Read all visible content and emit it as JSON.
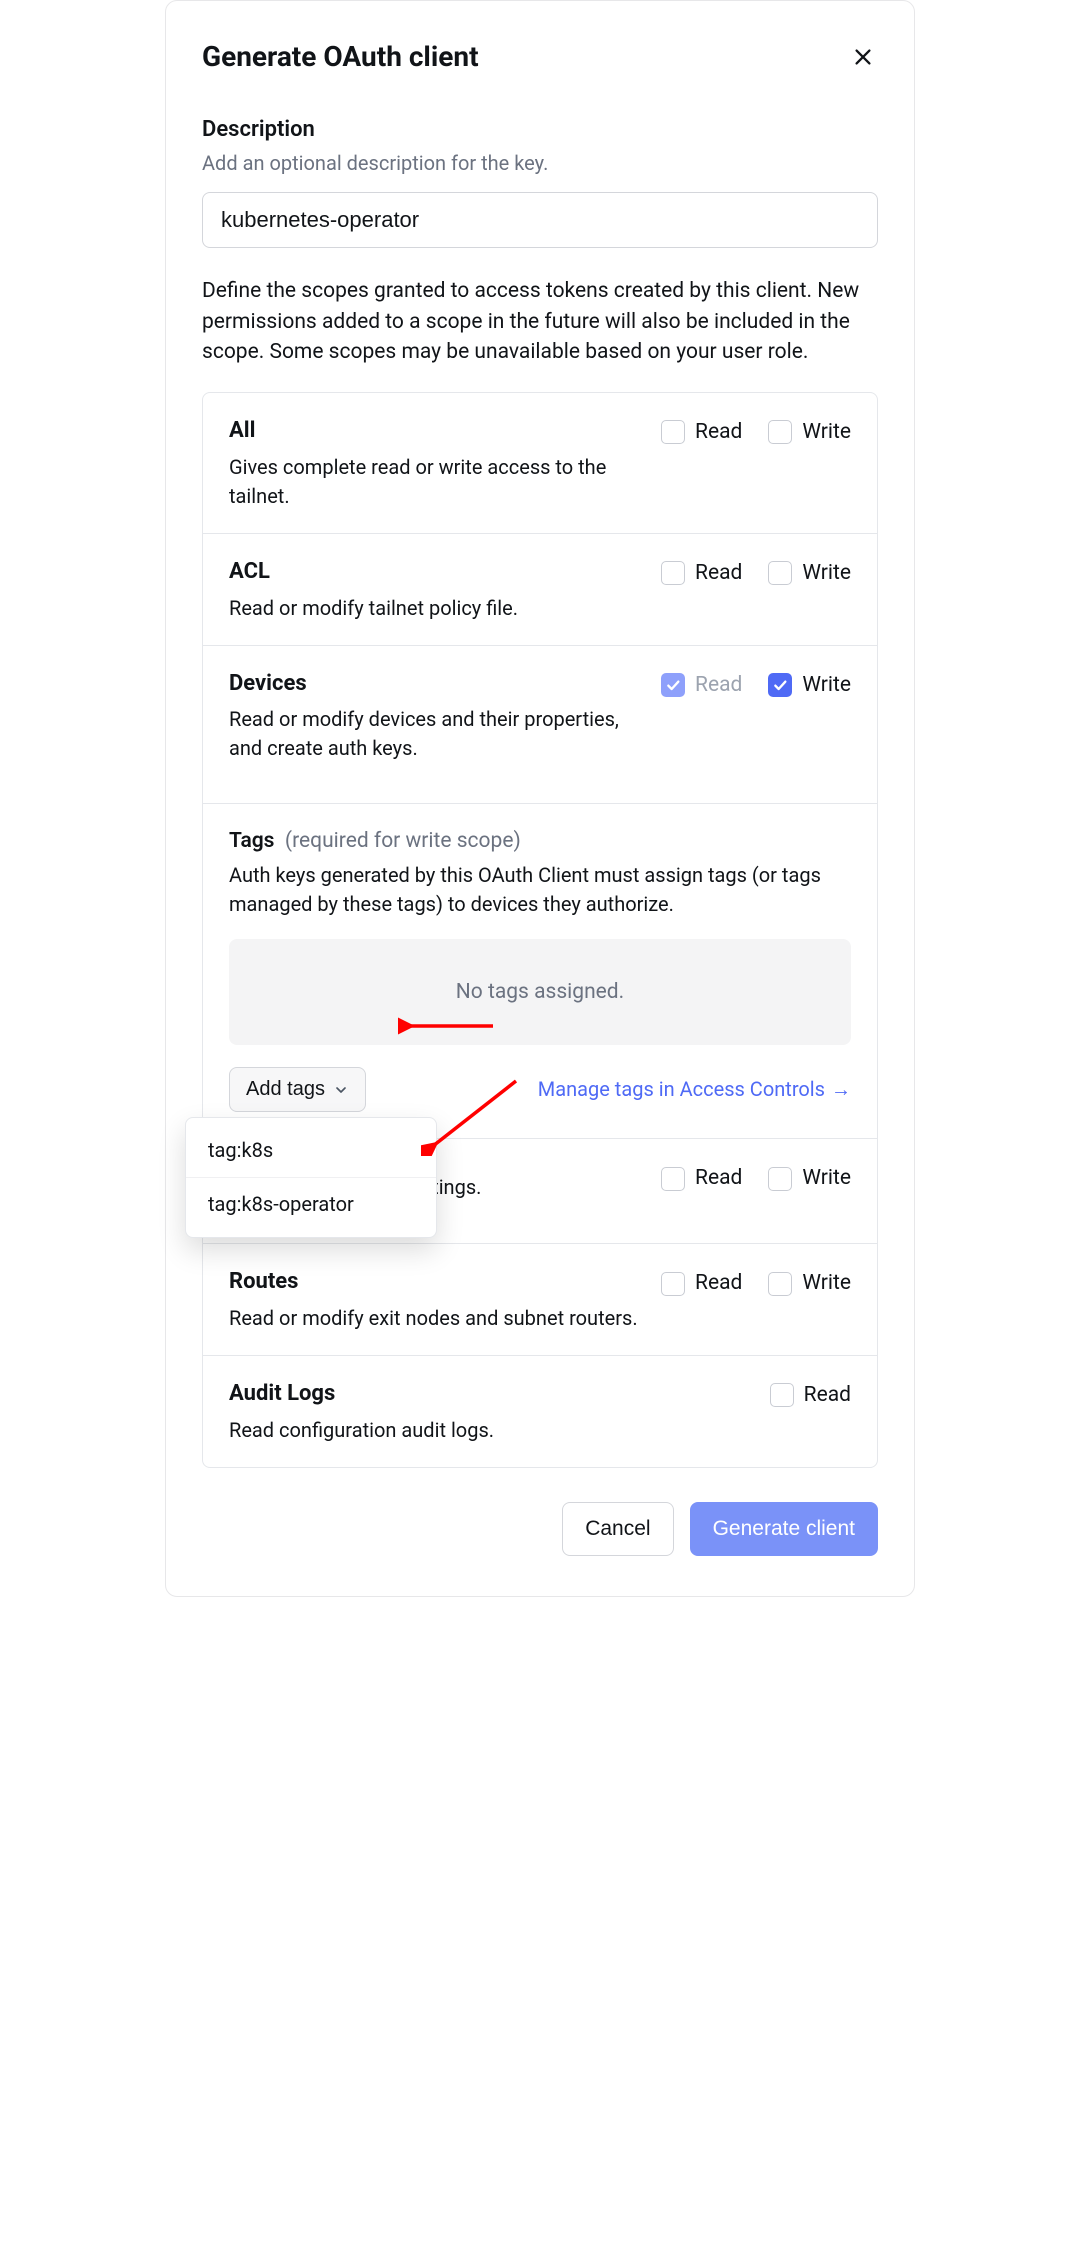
{
  "header": {
    "title": "Generate OAuth client"
  },
  "description": {
    "label": "Description",
    "hint": "Add an optional description for the key.",
    "value": "kubernetes-operator"
  },
  "scopes_intro": "Define the scopes granted to access tokens created by this client. New permissions added to a scope in the future will also be included in the scope. Some scopes may be unavailable based on your user role.",
  "scopes": {
    "all": {
      "name": "All",
      "desc": "Gives complete read or write access to the tailnet.",
      "read_label": "Read",
      "write_label": "Write"
    },
    "acl": {
      "name": "ACL",
      "desc": "Read or modify tailnet policy file.",
      "read_label": "Read",
      "write_label": "Write"
    },
    "devices": {
      "name": "Devices",
      "desc": "Read or modify devices and their properties, and create auth keys.",
      "read_label": "Read",
      "write_label": "Write"
    },
    "hidden": {
      "partial_desc": "ettings.",
      "read_label": "Read",
      "write_label": "Write"
    },
    "routes": {
      "name": "Routes",
      "desc": "Read or modify exit nodes and subnet routers.",
      "read_label": "Read",
      "write_label": "Write"
    },
    "audit": {
      "name": "Audit Logs",
      "desc": "Read configuration audit logs.",
      "read_label": "Read"
    }
  },
  "tags": {
    "title": "Tags",
    "required_hint": "(required for write scope)",
    "desc": "Auth keys generated by this OAuth Client must assign tags (or tags managed by these tags) to devices they authorize.",
    "empty": "No tags assigned.",
    "add_button": "Add tags",
    "manage_link": "Manage tags in Access Controls",
    "options": [
      "tag:k8s",
      "tag:k8s-operator"
    ]
  },
  "footer": {
    "cancel": "Cancel",
    "generate": "Generate client"
  },
  "colors": {
    "accent": "#4f6af5"
  }
}
